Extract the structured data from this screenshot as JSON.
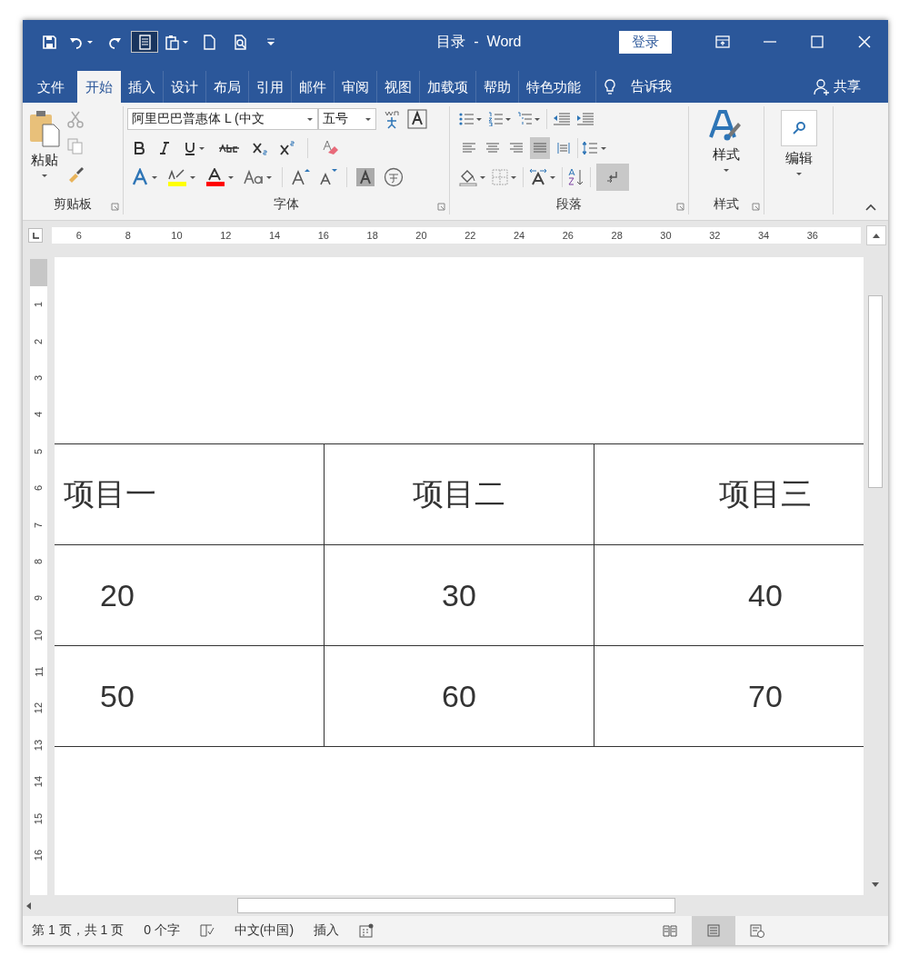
{
  "window": {
    "title": "目录  -  Word",
    "sign_in": "登录"
  },
  "quick_access": [
    {
      "kind": "save",
      "selected": false
    },
    {
      "kind": "undo",
      "selected": false
    },
    {
      "kind": "redo",
      "selected": false
    },
    {
      "kind": "page",
      "selected": true
    },
    {
      "kind": "paste",
      "selected": false
    },
    {
      "kind": "new",
      "selected": false
    },
    {
      "kind": "preview",
      "selected": false
    },
    {
      "kind": "customize",
      "selected": false
    }
  ],
  "tabs": [
    {
      "label": "文件",
      "selected": false
    },
    {
      "label": "开始",
      "selected": true
    },
    {
      "label": "插入",
      "selected": false
    },
    {
      "label": "设计",
      "selected": false
    },
    {
      "label": "布局",
      "selected": false
    },
    {
      "label": "引用",
      "selected": false
    },
    {
      "label": "邮件",
      "selected": false
    },
    {
      "label": "审阅",
      "selected": false
    },
    {
      "label": "视图",
      "selected": false
    },
    {
      "label": "加载项",
      "selected": false
    },
    {
      "label": "帮助",
      "selected": false
    },
    {
      "label": "特色功能",
      "selected": false
    }
  ],
  "tell_me": "告诉我",
  "share": "共享",
  "ribbon": {
    "clipboard": {
      "paste": "粘贴",
      "label": "剪贴板"
    },
    "font": {
      "font_name": "阿里巴巴普惠体 L (中文",
      "font_size": "五号",
      "label": "字体"
    },
    "paragraph": {
      "label": "段落",
      "alignments": [
        {
          "selected": false
        },
        {
          "selected": false
        },
        {
          "selected": false
        },
        {
          "selected": true
        },
        {
          "selected": false
        }
      ],
      "formatting_marks": {
        "on": true
      }
    },
    "styles": {
      "button": "样式",
      "label": "样式"
    },
    "editing": {
      "button": "编辑"
    }
  },
  "ruler": {
    "horizontal": [
      "6",
      "8",
      "10",
      "12",
      "14",
      "16",
      "18",
      "20",
      "22",
      "24",
      "26",
      "28",
      "30",
      "32",
      "34",
      "36"
    ],
    "vertical": [
      "1",
      "2",
      "3",
      "4",
      "5",
      "6",
      "7",
      "8",
      "9",
      "10",
      "11",
      "12",
      "13",
      "14",
      "15",
      "16"
    ]
  },
  "table": {
    "rows": [
      [
        "项目一",
        "项目二",
        "项目三"
      ],
      [
        "20",
        "30",
        "40"
      ],
      [
        "50",
        "60",
        "70"
      ]
    ]
  },
  "status_bar": {
    "page": "第 1 页，共 1 页",
    "words": "0 个字",
    "language": "中文(中国)",
    "mode": "插入",
    "views": [
      {
        "kind": "read",
        "selected": false
      },
      {
        "kind": "print",
        "selected": true
      },
      {
        "kind": "web",
        "selected": false
      }
    ]
  }
}
